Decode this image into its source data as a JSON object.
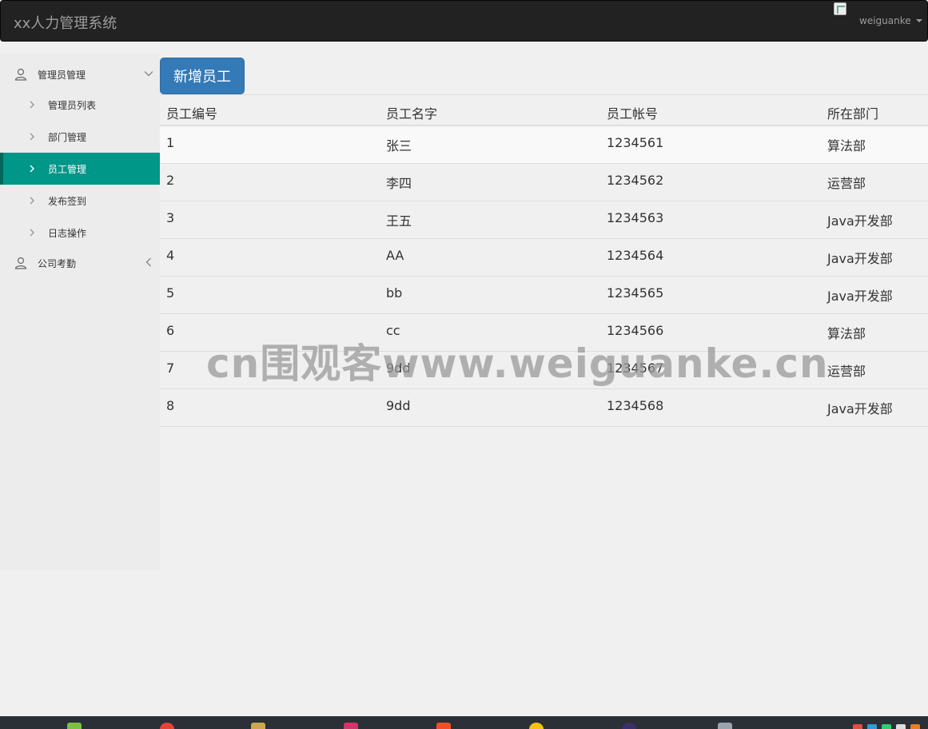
{
  "navbar": {
    "brand": "xx人力管理系统",
    "user": "weiguanke"
  },
  "sidebar": {
    "groups": [
      {
        "label": "管理员管理",
        "expanded": true,
        "icon": "user-icon",
        "items": [
          {
            "label": "管理员列表",
            "active": false
          },
          {
            "label": "部门管理",
            "active": false
          },
          {
            "label": "员工管理",
            "active": true
          },
          {
            "label": "发布签到",
            "active": false
          },
          {
            "label": "日志操作",
            "active": false
          }
        ]
      },
      {
        "label": "公司考勤",
        "expanded": false,
        "icon": "user-icon",
        "items": []
      }
    ],
    "active_color": "#009688"
  },
  "toolbar": {
    "add_label": "新增员工",
    "add_color": "#337ab7"
  },
  "table": {
    "headers": [
      "员工编号",
      "员工名字",
      "员工帐号",
      "所在部门"
    ],
    "rows": [
      [
        "1",
        "张三",
        "1234561",
        "算法部"
      ],
      [
        "2",
        "李四",
        "1234562",
        "运营部"
      ],
      [
        "3",
        "王五",
        "1234563",
        "Java开发部"
      ],
      [
        "4",
        "AA",
        "1234564",
        "Java开发部"
      ],
      [
        "5",
        "bb",
        "1234565",
        "Java开发部"
      ],
      [
        "6",
        "cc",
        "1234566",
        "算法部"
      ],
      [
        "7",
        "9dd",
        "1234567",
        "运营部"
      ],
      [
        "8",
        "9dd",
        "1234568",
        "Java开发部"
      ]
    ]
  },
  "watermark": "cn围观客www.weiguanke.cn"
}
